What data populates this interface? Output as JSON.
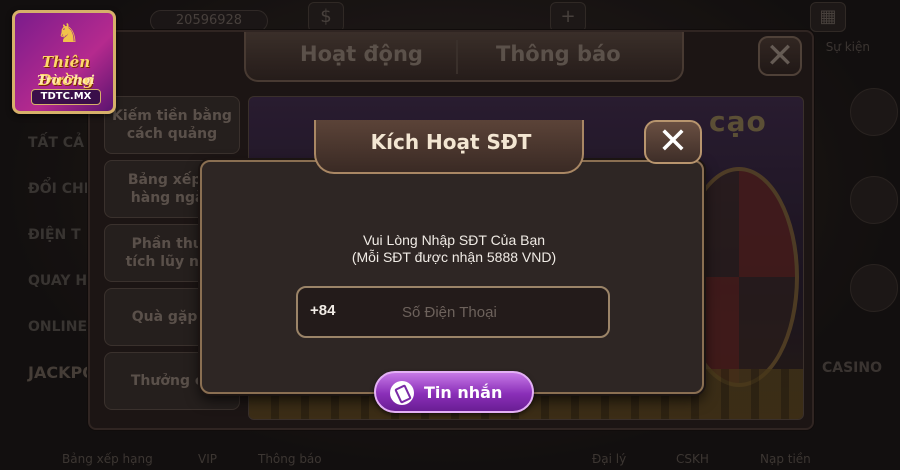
{
  "lobby": {
    "balance": "20596928",
    "right_top_label": "Sự kiện",
    "left_menu": [
      "TẤT CẢ",
      "ĐỔI CHIP",
      "ĐIỆN T",
      "QUAY H",
      "ONLINE",
      "JACKPOT"
    ],
    "casino_label": "CASINO",
    "bottom_nav": [
      "Bảng xếp hạng",
      "VIP",
      "Thông báo",
      "Đại lý",
      "CSKH",
      "Nạp tiền"
    ]
  },
  "logo": {
    "line1": "Thiên Đường",
    "line2": "Trò Chơi",
    "badge": "TDTC.MX"
  },
  "main_panel": {
    "tabs": [
      "Hoạt động",
      "Thông báo"
    ],
    "close_symbol": "✕",
    "side_items": [
      "Kiếm tiền bằng\ncách quảng",
      "Bảng xếp h\nhàng ngày",
      "Phần thưở\ntích lũy nạp",
      "Quà gặp n",
      "Thưởng ch"
    ],
    "promo_title": "cạo"
  },
  "modal": {
    "title": "Kích Hoạt SĐT",
    "close_symbol": "✕",
    "instruction_line1": "Vui Lòng Nhập SĐT Của Bạn",
    "instruction_line2": "(Mỗi SĐT được nhận 5888 VND)",
    "phone_prefix": "+84",
    "phone_placeholder": "Số Điện Thoại",
    "phone_value": "",
    "sms_button_label": "Tin nhắn"
  },
  "colors": {
    "accent_purple": "#8a2fb8",
    "gold_border": "#d6b06a"
  }
}
